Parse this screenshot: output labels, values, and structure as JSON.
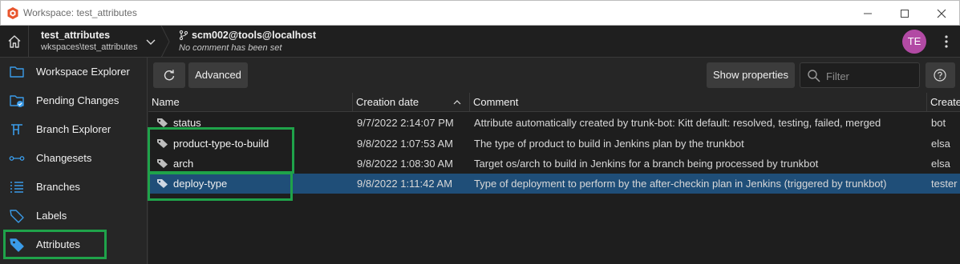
{
  "window": {
    "title": "Workspace: test_attributes"
  },
  "header": {
    "workspace_name": "test_attributes",
    "workspace_path": "wkspaces\\test_attributes",
    "branch": "scm002@tools@localhost",
    "branch_comment": "No comment has been set",
    "avatar_initials": "TE",
    "avatar_color": "#b24aa4"
  },
  "sidebar": {
    "items": [
      {
        "label": "Workspace Explorer",
        "icon": "folder-icon"
      },
      {
        "label": "Pending Changes",
        "icon": "pending-changes-icon"
      },
      {
        "label": "Branch Explorer",
        "icon": "branch-explorer-icon"
      },
      {
        "label": "Changesets",
        "icon": "changesets-icon"
      },
      {
        "label": "Branches",
        "icon": "list-icon"
      },
      {
        "label": "Labels",
        "icon": "tag-icon"
      },
      {
        "label": "Attributes",
        "icon": "attribute-tag-icon",
        "active": true
      }
    ]
  },
  "toolbar": {
    "advanced_label": "Advanced",
    "show_properties_label": "Show properties",
    "filter_placeholder": "Filter"
  },
  "table": {
    "columns": {
      "name": "Name",
      "creation_date": "Creation date",
      "comment": "Comment",
      "creator": "Create"
    },
    "sort": {
      "column": "Creation date",
      "direction": "ascending"
    },
    "rows": [
      {
        "name": "status",
        "date": "9/7/2022 2:14:07 PM",
        "comment": "Attribute automatically created by trunk-bot: Kitt default: resolved, testing, failed, merged",
        "creator": "bot"
      },
      {
        "name": "product-type-to-build",
        "date": "9/8/2022 1:07:53 AM",
        "comment": "The type of product to build in Jenkins plan by the trunkbot",
        "creator": "elsa"
      },
      {
        "name": "arch",
        "date": "9/8/2022 1:08:30 AM",
        "comment": "Target os/arch to build in Jenkins for a branch being processed by trunkbot",
        "creator": "elsa"
      },
      {
        "name": "deploy-type",
        "date": "9/8/2022 1:11:42 AM",
        "comment": "Type of deployment to perform by the after-checkin plan in Jenkins (triggered by trunkbot)",
        "creator": "tester",
        "selected": true
      }
    ]
  },
  "colors": {
    "highlight": "#1fa34a",
    "selection": "#1f4e78",
    "accent": "#3a9be8"
  }
}
